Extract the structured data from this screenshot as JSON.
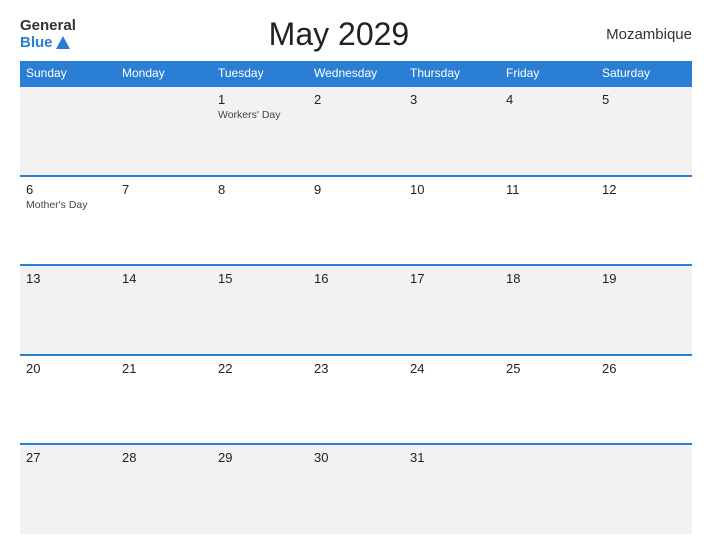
{
  "header": {
    "logo_general": "General",
    "logo_blue": "Blue",
    "title": "May 2029",
    "country": "Mozambique"
  },
  "weekdays": [
    "Sunday",
    "Monday",
    "Tuesday",
    "Wednesday",
    "Thursday",
    "Friday",
    "Saturday"
  ],
  "weeks": [
    [
      {
        "day": "",
        "holiday": ""
      },
      {
        "day": "",
        "holiday": ""
      },
      {
        "day": "1",
        "holiday": "Workers' Day"
      },
      {
        "day": "2",
        "holiday": ""
      },
      {
        "day": "3",
        "holiday": ""
      },
      {
        "day": "4",
        "holiday": ""
      },
      {
        "day": "5",
        "holiday": ""
      }
    ],
    [
      {
        "day": "6",
        "holiday": "Mother's Day"
      },
      {
        "day": "7",
        "holiday": ""
      },
      {
        "day": "8",
        "holiday": ""
      },
      {
        "day": "9",
        "holiday": ""
      },
      {
        "day": "10",
        "holiday": ""
      },
      {
        "day": "11",
        "holiday": ""
      },
      {
        "day": "12",
        "holiday": ""
      }
    ],
    [
      {
        "day": "13",
        "holiday": ""
      },
      {
        "day": "14",
        "holiday": ""
      },
      {
        "day": "15",
        "holiday": ""
      },
      {
        "day": "16",
        "holiday": ""
      },
      {
        "day": "17",
        "holiday": ""
      },
      {
        "day": "18",
        "holiday": ""
      },
      {
        "day": "19",
        "holiday": ""
      }
    ],
    [
      {
        "day": "20",
        "holiday": ""
      },
      {
        "day": "21",
        "holiday": ""
      },
      {
        "day": "22",
        "holiday": ""
      },
      {
        "day": "23",
        "holiday": ""
      },
      {
        "day": "24",
        "holiday": ""
      },
      {
        "day": "25",
        "holiday": ""
      },
      {
        "day": "26",
        "holiday": ""
      }
    ],
    [
      {
        "day": "27",
        "holiday": ""
      },
      {
        "day": "28",
        "holiday": ""
      },
      {
        "day": "29",
        "holiday": ""
      },
      {
        "day": "30",
        "holiday": ""
      },
      {
        "day": "31",
        "holiday": ""
      },
      {
        "day": "",
        "holiday": ""
      },
      {
        "day": "",
        "holiday": ""
      }
    ]
  ]
}
